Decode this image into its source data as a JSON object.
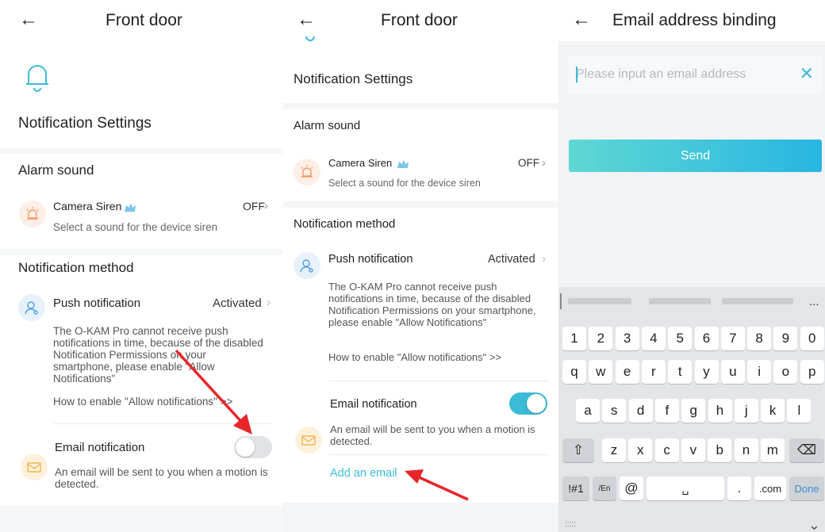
{
  "panel1": {
    "title": "Front door",
    "notification_settings": "Notification Settings",
    "alarm_sound": "Alarm sound",
    "camera_siren": "Camera Siren",
    "camera_siren_sub": "Select a sound for the device siren",
    "camera_siren_value": "OFF",
    "notification_method": "Notification method",
    "push_title": "Push notification",
    "push_value": "Activated",
    "push_desc": "The O-KAM Pro cannot receive push notifications in time, because of the disabled Notification Permissions on your smartphone, please enable \"Allow Notifications\"",
    "push_link": "How to enable \"Allow notifications\" >>",
    "email_title": "Email notification",
    "email_desc": "An email will be sent to you when a motion is detected.",
    "email_toggle": "off"
  },
  "panel2": {
    "title": "Front door",
    "notification_settings": "Notification Settings",
    "alarm_sound": "Alarm sound",
    "camera_siren": "Camera Siren",
    "camera_siren_sub": "Select a sound for the device siren",
    "camera_siren_value": "OFF",
    "notification_method": "Notification method",
    "push_title": "Push notification",
    "push_value": "Activated",
    "push_desc": "The O-KAM Pro cannot receive push notifications in time, because of the disabled Notification Permissions on your smartphone, please enable \"Allow Notifications\"",
    "push_link": "How to enable \"Allow notifications\" >>",
    "email_title": "Email notification",
    "email_desc": "An email will be sent to you when a motion is detected.",
    "email_toggle": "on",
    "add_email": "Add an email"
  },
  "panel3": {
    "title": "Email address binding",
    "email_placeholder": "Please input an email address",
    "send_label": "Send",
    "keyboard": {
      "more": "...",
      "row1": [
        "1",
        "2",
        "3",
        "4",
        "5",
        "6",
        "7",
        "8",
        "9",
        "0"
      ],
      "row2": [
        "q",
        "w",
        "e",
        "r",
        "t",
        "y",
        "u",
        "i",
        "o",
        "p"
      ],
      "row3": [
        "a",
        "s",
        "d",
        "f",
        "g",
        "h",
        "j",
        "k",
        "l"
      ],
      "row4": [
        "z",
        "x",
        "c",
        "v",
        "b",
        "n",
        "m"
      ],
      "sym": "!#1",
      "lang": "/En",
      "at": "@",
      "dot": ".",
      "com": ".com",
      "done": "Done",
      "shift_glyph": "⇧",
      "backspace_glyph": "⌫",
      "space_glyph": "␣",
      "dots": ":::::",
      "hide_glyph": "⌄"
    }
  },
  "colors": {
    "accent": "#3bbbd6",
    "annotation_arrow": "#e8262a",
    "bell": "#3bbbd6"
  }
}
